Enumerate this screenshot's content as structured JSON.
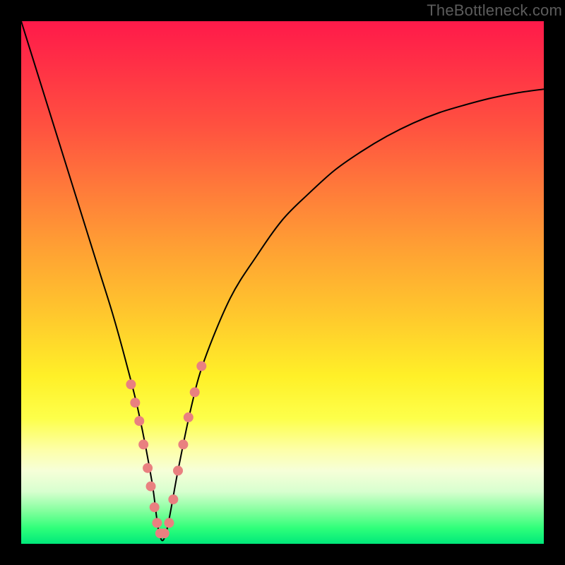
{
  "watermark": "TheBottleneck.com",
  "chart_data": {
    "type": "line",
    "title": "",
    "xlabel": "",
    "ylabel": "",
    "xlim": [
      0,
      100
    ],
    "ylim": [
      0,
      100
    ],
    "grid": false,
    "legend": false,
    "series": [
      {
        "name": "bottleneck-curve",
        "x": [
          0,
          2.5,
          5,
          7.5,
          10,
          12.5,
          15,
          17.5,
          20,
          22.5,
          25,
          26.4,
          27.7,
          30,
          32.5,
          35,
          40,
          45,
          50,
          55,
          60,
          65,
          70,
          75,
          80,
          85,
          90,
          95,
          100
        ],
        "y": [
          100,
          92,
          84,
          76,
          68,
          60,
          52,
          44,
          35,
          25,
          12,
          2,
          2,
          14,
          26,
          35,
          47,
          55,
          62,
          67,
          71.5,
          75,
          78,
          80.5,
          82.5,
          84,
          85.3,
          86.3,
          87
        ]
      }
    ],
    "markers": {
      "name": "sample-points",
      "color": "#e98080",
      "radius": 7,
      "points": [
        {
          "x": 21.0,
          "y": 30.5
        },
        {
          "x": 21.8,
          "y": 27.0
        },
        {
          "x": 22.6,
          "y": 23.5
        },
        {
          "x": 23.4,
          "y": 19.0
        },
        {
          "x": 24.2,
          "y": 14.5
        },
        {
          "x": 24.8,
          "y": 11.0
        },
        {
          "x": 25.5,
          "y": 7.0
        },
        {
          "x": 26.0,
          "y": 4.0
        },
        {
          "x": 26.6,
          "y": 2.0
        },
        {
          "x": 27.4,
          "y": 2.0
        },
        {
          "x": 28.3,
          "y": 4.0
        },
        {
          "x": 29.1,
          "y": 8.5
        },
        {
          "x": 30.0,
          "y": 14.0
        },
        {
          "x": 31.0,
          "y": 19.0
        },
        {
          "x": 32.0,
          "y": 24.2
        },
        {
          "x": 33.2,
          "y": 29.0
        },
        {
          "x": 34.5,
          "y": 34.0
        }
      ]
    },
    "gradient": {
      "direction": "vertical",
      "stops": [
        {
          "pos": 0,
          "color": "#ff1a4a"
        },
        {
          "pos": 20,
          "color": "#ff5140"
        },
        {
          "pos": 44,
          "color": "#ffa233"
        },
        {
          "pos": 68,
          "color": "#fff028"
        },
        {
          "pos": 86,
          "color": "#f6ffd8"
        },
        {
          "pos": 100,
          "color": "#00e87a"
        }
      ]
    }
  }
}
